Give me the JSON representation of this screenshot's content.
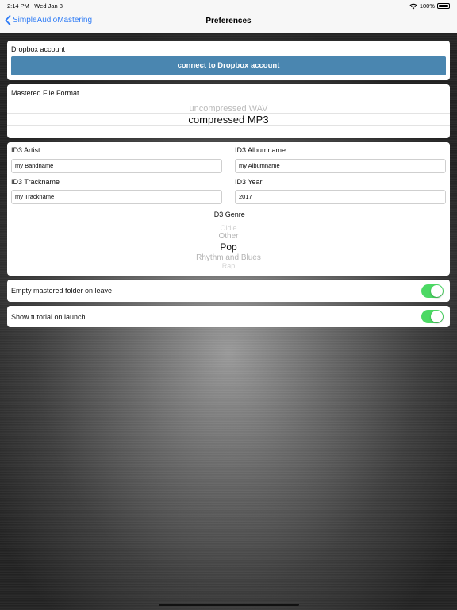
{
  "status_bar": {
    "time": "2:14 PM",
    "date": "Wed Jan 8",
    "battery": "100%"
  },
  "nav": {
    "back_label": "SimpleAudioMastering",
    "title": "Preferences",
    "accent": "#2f7cf6"
  },
  "dropbox": {
    "label": "Dropbox account",
    "button_label": "connect to Dropbox account",
    "button_color": "#4a86b0"
  },
  "file_format": {
    "label": "Mastered File Format",
    "options": [
      "uncompressed WAV",
      "compressed MP3"
    ],
    "selected": "compressed MP3"
  },
  "id3": {
    "artist_label": "ID3 Artist",
    "artist_value": "my Bandname",
    "album_label": "ID3 Albumname",
    "album_value": "my Albumname",
    "track_label": "ID3 Trackname",
    "track_value": "my Trackname",
    "year_label": "ID3 Year",
    "year_value": "2017",
    "genre_label": "ID3 Genre",
    "genre_options": [
      "Oldie",
      "Other",
      "Pop",
      "Rhythm and Blues",
      "Rap"
    ],
    "genre_selected": "Pop"
  },
  "settings": {
    "empty_folder_label": "Empty mastered folder on leave",
    "empty_folder_on": true,
    "tutorial_label": "Show tutorial on launch",
    "tutorial_on": true,
    "toggle_color": "#4cd964"
  }
}
